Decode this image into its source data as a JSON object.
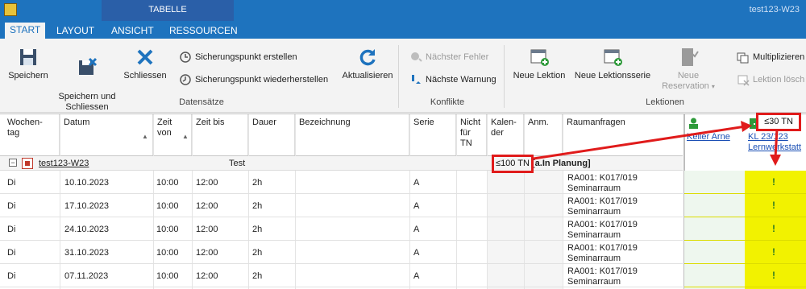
{
  "window": {
    "context_tab_group": "TABELLE",
    "title": "test123-W23"
  },
  "tabs": [
    {
      "label": "START",
      "active": true
    },
    {
      "label": "LAYOUT",
      "active": false
    },
    {
      "label": "ANSICHT",
      "active": false
    },
    {
      "label": "RESSOURCEN",
      "active": false
    }
  ],
  "ribbon": {
    "save": "Speichern",
    "save_close": "Speichern und\nSchliessen",
    "close": "Schliessen",
    "create_checkpoint": "Sicherungspunkt erstellen",
    "restore_checkpoint": "Sicherungspunkt wiederherstellen",
    "refresh": "Aktualisieren",
    "next_error": "Nächster Fehler",
    "next_warning": "Nächste Warnung",
    "new_lesson": "Neue Lektion",
    "new_lesson_series": "Neue Lektionsserie",
    "new_reservation": "Neue Reservation",
    "multiply": "Multiplizieren",
    "delete_lesson": "Lektion lösch",
    "groups": {
      "records": "Datensätze",
      "conflicts": "Konflikte",
      "lessons": "Lektionen"
    }
  },
  "table": {
    "headers": {
      "weekday": "Wochen-\ntag",
      "date": "Datum",
      "time_from": "Zeit\nvon",
      "time_to": "Zeit bis",
      "duration": "Dauer",
      "description": "Bezeichnung",
      "series": "Serie",
      "not_for_tn": "Nicht\nfür\nTN",
      "calendar": "Kalen-\nder",
      "anm": "Anm.",
      "room_requests": "Raumanfragen"
    },
    "group": {
      "link": "test123-W23",
      "name": "Test",
      "capacity": "≤100 TN",
      "status_tail": "[a.In Planung]"
    },
    "rows": [
      {
        "weekday": "Di",
        "date": "10.10.2023",
        "from": "10:00",
        "to": "12:00",
        "duration": "2h",
        "series": "A",
        "room": "RA001: K017/019\nSeminarraum"
      },
      {
        "weekday": "Di",
        "date": "17.10.2023",
        "from": "10:00",
        "to": "12:00",
        "duration": "2h",
        "series": "A",
        "room": "RA001: K017/019\nSeminarraum"
      },
      {
        "weekday": "Di",
        "date": "24.10.2023",
        "from": "10:00",
        "to": "12:00",
        "duration": "2h",
        "series": "A",
        "room": "RA001: K017/019\nSeminarraum"
      },
      {
        "weekday": "Di",
        "date": "31.10.2023",
        "from": "10:00",
        "to": "12:00",
        "duration": "2h",
        "series": "A",
        "room": "RA001: K017/019\nSeminarraum"
      },
      {
        "weekday": "Di",
        "date": "07.11.2023",
        "from": "10:00",
        "to": "12:00",
        "duration": "2h",
        "series": "A",
        "room": "RA001: K017/019\nSeminarraum"
      }
    ]
  },
  "resources": {
    "person": "Keller Arne",
    "room_capacity": "≤30 TN",
    "room_line1": "KL 23/123",
    "room_line2": "Lernwerkstatt",
    "marks": [
      "!",
      "!",
      "!",
      "!",
      "!"
    ]
  },
  "colors": {
    "accent": "#1e73be",
    "highlight": "#e01b1b",
    "conflict": "#f2f200"
  }
}
